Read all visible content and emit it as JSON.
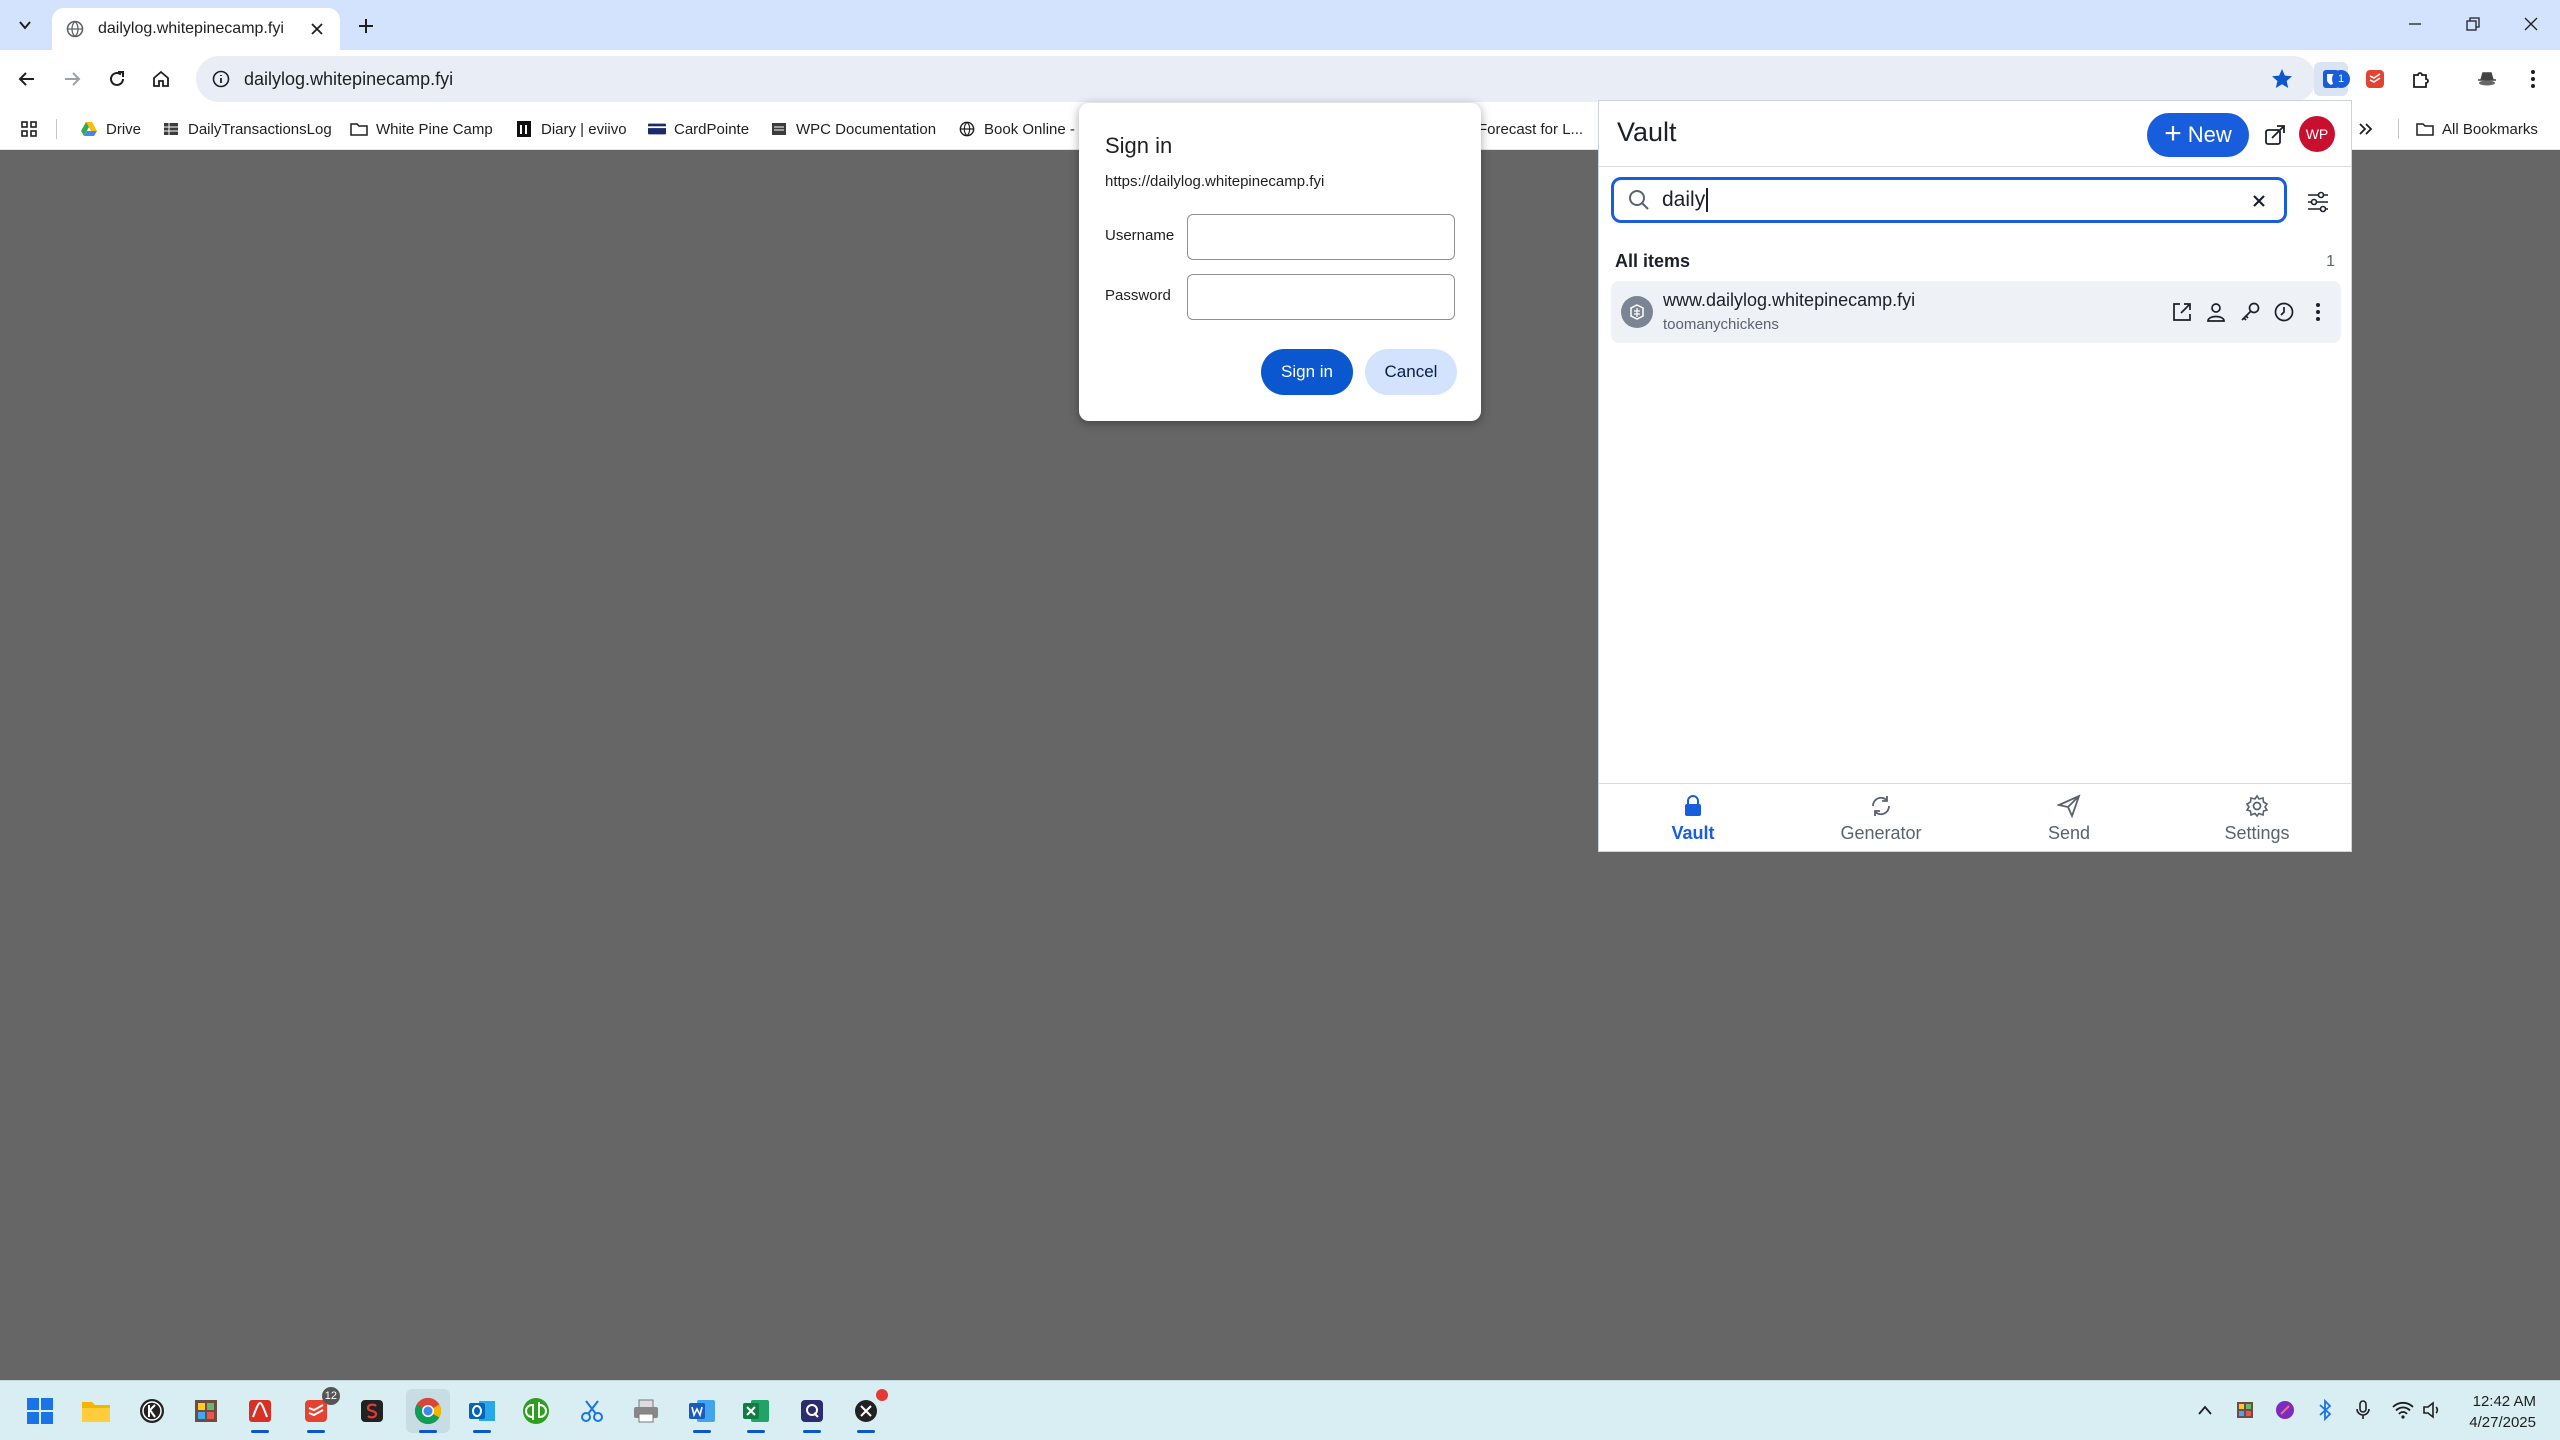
{
  "browser": {
    "tab": {
      "title": "dailylog.whitepinecamp.fyi"
    },
    "address": {
      "url": "dailylog.whitepinecamp.fyi"
    },
    "bookmarks": [
      {
        "label": "Drive",
        "icon": "drive-icon"
      },
      {
        "label": "DailyTransactionsLog",
        "icon": "sheet-icon"
      },
      {
        "label": "White Pine Camp",
        "icon": "folder-icon"
      },
      {
        "label": "Diary | eviivo",
        "icon": "eviivo-icon"
      },
      {
        "label": "CardPointe",
        "icon": "card-icon"
      },
      {
        "label": "WPC Documentation",
        "icon": "doc-icon"
      },
      {
        "label": "Book Online -",
        "icon": "globe-icon"
      },
      {
        "label": "Forecast for L...",
        "icon": "weather-icon"
      }
    ],
    "all_bookmarks": "All Bookmarks",
    "extension_badge": "1"
  },
  "signin": {
    "title": "Sign in",
    "origin": "https://dailylog.whitepinecamp.fyi",
    "username_label": "Username",
    "username_value": "",
    "password_label": "Password",
    "password_value": "",
    "submit": "Sign in",
    "cancel": "Cancel"
  },
  "vault": {
    "title": "Vault",
    "new_label": "New",
    "avatar": "WP",
    "search_value": "daily",
    "section_title": "All items",
    "section_count": "1",
    "items": [
      {
        "name": "www.dailylog.whitepinecamp.fyi",
        "username": "toomanychickens"
      }
    ],
    "nav": [
      {
        "label": "Vault",
        "icon": "lock-icon",
        "active": true
      },
      {
        "label": "Generator",
        "icon": "refresh-icon",
        "active": false
      },
      {
        "label": "Send",
        "icon": "send-icon",
        "active": false
      },
      {
        "label": "Settings",
        "icon": "gear-icon",
        "active": false
      }
    ],
    "colors": {
      "primary": "#175ddc",
      "avatar": "#c8102e"
    }
  },
  "taskbar": {
    "apps": [
      "start",
      "file-explorer",
      "app-k",
      "app-grid",
      "app-pdf",
      "todoist",
      "app-s",
      "chrome",
      "outlook",
      "quickbooks",
      "snipping-tool",
      "printer",
      "word",
      "excel",
      "app-q",
      "app-dark"
    ],
    "todoist_badge": "12",
    "clock_time": "12:42 AM",
    "clock_date": "4/27/2025"
  }
}
